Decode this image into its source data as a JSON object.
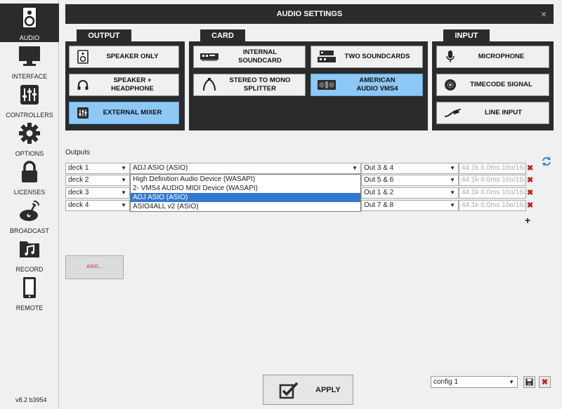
{
  "title": "AUDIO SETTINGS",
  "close_glyph": "×",
  "version": "v8.2 b3954",
  "sidebar": [
    {
      "label": "AUDIO",
      "icon": "speaker-icon",
      "active": true
    },
    {
      "label": "INTERFACE",
      "icon": "monitor-icon"
    },
    {
      "label": "CONTROLLERS",
      "icon": "sliders-icon"
    },
    {
      "label": "OPTIONS",
      "icon": "gear-icon"
    },
    {
      "label": "LICENSES",
      "icon": "lock-icon"
    },
    {
      "label": "BROADCAST",
      "icon": "broadcast-icon"
    },
    {
      "label": "RECORD",
      "icon": "music-folder-icon"
    },
    {
      "label": "REMOTE",
      "icon": "tablet-icon"
    }
  ],
  "sections": {
    "output": "OUTPUT",
    "card": "CARD",
    "input": "INPUT"
  },
  "output_buttons": [
    "SPEAKER ONLY",
    "SPEAKER +\nHEADPHONE",
    "EXTERNAL MIXER"
  ],
  "card_buttons": [
    "INTERNAL\nSOUNDCARD",
    "TWO SOUNDCARDS",
    "STEREO TO MONO\nSPLITTER",
    "AMERICAN\nAUDIO VMS4"
  ],
  "input_buttons": [
    "MICROPHONE",
    "TIMECODE SIGNAL",
    "LINE INPUT"
  ],
  "outputs_label": "Outputs",
  "rows": [
    {
      "deck": "deck 1",
      "device": "ADJ ASIO (ASIO)",
      "channel": "Out 3 & 4",
      "info": "44.1k 6.0ms 16o/16i"
    },
    {
      "deck": "deck 2",
      "device": "",
      "channel": "Out 5 & 6",
      "info": "44.1k 6.0ms 16o/16i"
    },
    {
      "deck": "deck 3",
      "device": "",
      "channel": "Out 1 & 2",
      "info": "44.1k 6.0ms 16o/16i"
    },
    {
      "deck": "deck 4",
      "device": "",
      "channel": "Out 7 & 8",
      "info": "44.1k 6.0ms 16o/16i"
    }
  ],
  "dropdown_options": [
    "High Definition Audio Device (WASAPI)",
    "2- VMS4 AUDIO MIDI Device (WASAPI)",
    "ADJ ASIO (ASIO)",
    "ASIO4ALL v2 (ASIO)"
  ],
  "dropdown_highlight": 2,
  "delete_glyph": "✖",
  "add_glyph": "+",
  "asio_button": "ASIO...",
  "apply": "APPLY",
  "config": "config 1",
  "colors": {
    "dark": "#2b2b2b",
    "selected": "#8ec8f6",
    "delete": "#c02020",
    "highlight": "#3478d0"
  }
}
